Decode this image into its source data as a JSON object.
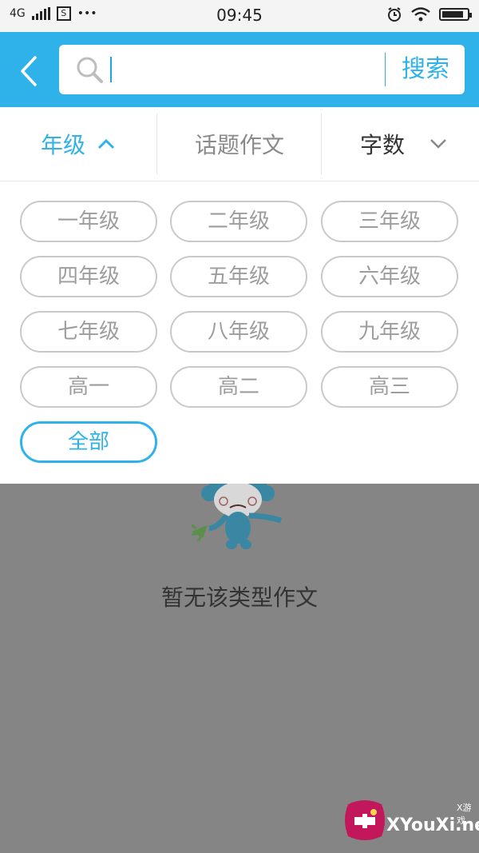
{
  "status_bar": {
    "network": "4G",
    "time": "09:45",
    "dots": "•••",
    "sim_label": "S",
    "battery_level": 0.85
  },
  "header": {
    "search_placeholder": "",
    "search_button": "搜索"
  },
  "filters": {
    "grade": "年级",
    "topic": "话题作文",
    "words": "字数"
  },
  "grade_options": [
    "一年级",
    "二年级",
    "三年级",
    "四年级",
    "五年级",
    "六年级",
    "七年级",
    "八年级",
    "九年级",
    "高一",
    "高二",
    "高三",
    "全部"
  ],
  "selected_grade": "全部",
  "empty_state": {
    "message": "暂无该类型作文"
  },
  "watermark": {
    "text": "XYouXi.net",
    "small": "X游戏"
  },
  "colors": {
    "accent": "#2fb2ea",
    "overlay": "#858585"
  }
}
